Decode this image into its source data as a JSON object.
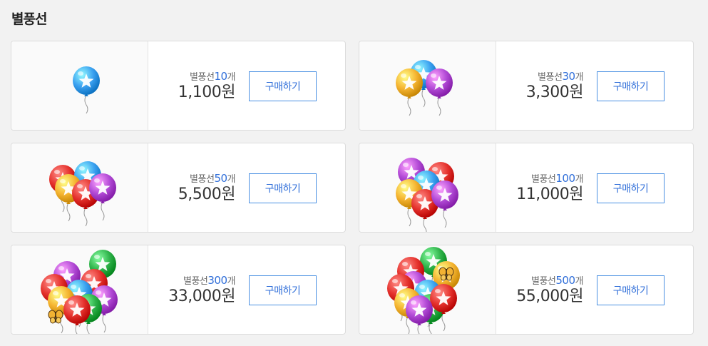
{
  "page": {
    "title": "별풍선"
  },
  "products": [
    {
      "prefix": "별풍선",
      "count": "10",
      "unit": "개",
      "price": "1,100원",
      "button": "구매하기",
      "balloons": [
        "blue"
      ]
    },
    {
      "prefix": "별풍선",
      "count": "30",
      "unit": "개",
      "price": "3,300원",
      "button": "구매하기",
      "balloons": [
        "blue",
        "orange",
        "purple"
      ]
    },
    {
      "prefix": "별풍선",
      "count": "50",
      "unit": "개",
      "price": "5,500원",
      "button": "구매하기",
      "balloons": [
        "red",
        "blue",
        "orange",
        "red",
        "purple"
      ]
    },
    {
      "prefix": "별풍선",
      "count": "100",
      "unit": "개",
      "price": "11,000원",
      "button": "구매하기",
      "balloons": [
        "purple",
        "red",
        "blue",
        "orange",
        "red",
        "purple"
      ]
    },
    {
      "prefix": "별풍선",
      "count": "300",
      "unit": "개",
      "price": "33,000원",
      "button": "구매하기",
      "balloons": [
        "green",
        "purple",
        "red",
        "red",
        "blue",
        "orange",
        "purple",
        "green",
        "red"
      ]
    },
    {
      "prefix": "별풍선",
      "count": "500",
      "unit": "개",
      "price": "55,000원",
      "button": "구매하기",
      "balloons": [
        "green",
        "red",
        "purple",
        "orange",
        "red",
        "blue",
        "orange",
        "green",
        "red",
        "purple"
      ]
    }
  ],
  "colors": {
    "blue": "#3aa0f0",
    "orange": "#f5b431",
    "purple": "#b24ad6",
    "red": "#e5322d",
    "green": "#2fb34a",
    "accent": "#2f6ed9"
  }
}
